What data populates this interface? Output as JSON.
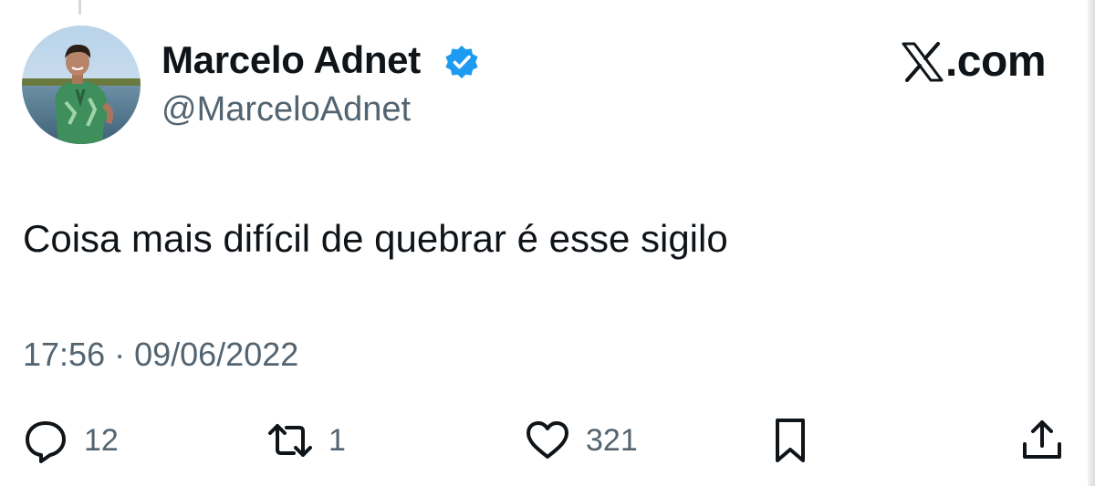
{
  "author": {
    "display_name": "Marcelo Adnet",
    "handle": "@MarceloAdnet",
    "verified": true,
    "verified_color": "#1d9bf0"
  },
  "brand": {
    "text": ".com",
    "icon": "x-logo-icon"
  },
  "tweet": {
    "text": "Coisa mais difícil de quebrar é esse sigilo",
    "timestamp": "17:56 · 09/06/2022"
  },
  "actions": {
    "reply": {
      "icon": "reply-icon",
      "count": "12"
    },
    "retweet": {
      "icon": "retweet-icon",
      "count": "1"
    },
    "like": {
      "icon": "heart-icon",
      "count": "321"
    },
    "bookmark": {
      "icon": "bookmark-icon"
    },
    "share": {
      "icon": "share-icon"
    }
  },
  "colors": {
    "text": "#0f1419",
    "secondary": "#536471",
    "background": "#ffffff"
  }
}
